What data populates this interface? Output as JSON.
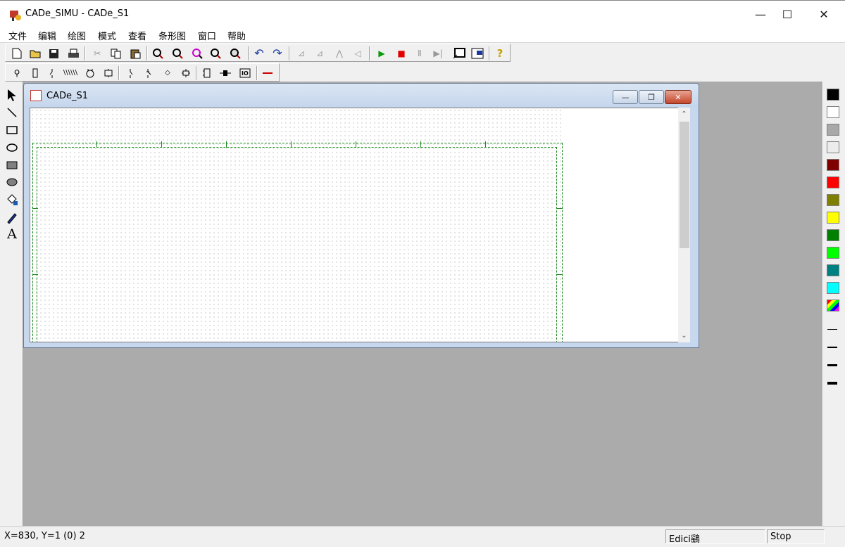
{
  "app": {
    "title": "CADe_SIMU - CADe_S1",
    "controls": {
      "minimize": "—",
      "maximize": "☐",
      "close": "✕"
    }
  },
  "menu": {
    "items": [
      "文件",
      "编辑",
      "绘图",
      "模式",
      "查看",
      "条形图",
      "窗口",
      "帮助"
    ]
  },
  "toolbar_main": {
    "icons": [
      "new-file-icon",
      "open-folder-icon",
      "save-icon",
      "print-icon",
      "cut-icon",
      "copy-icon",
      "paste-icon",
      "zoom-in-icon",
      "zoom-out-icon",
      "zoom-window-icon",
      "zoom-fit-icon",
      "pan-icon",
      "undo-icon",
      "redo-icon",
      "rotate-left-icon",
      "rotate-right-icon",
      "mirror-h-icon",
      "mirror-v-icon",
      "run-icon",
      "stop-icon",
      "pause-icon",
      "step-icon",
      "window-frame-icon",
      "tile-windows-icon",
      "help-icon"
    ]
  },
  "toolbar_components": {
    "icons": [
      "power-source-icon",
      "fuse-icon",
      "contact-icon",
      "switch-icon",
      "motor-icon",
      "relay-icon",
      "contact-no-icon",
      "contact-nc-icon",
      "diode-icon",
      "junction-icon",
      "terminal-icon",
      "coil-icon",
      "plc-io-icon",
      "wire-icon"
    ]
  },
  "tools_left": {
    "icons": [
      "pointer-icon",
      "line-icon",
      "rectangle-icon",
      "ellipse-icon",
      "filled-rectangle-icon",
      "filled-ellipse-icon",
      "fill-bucket-icon",
      "pen-icon",
      "text-icon"
    ],
    "text_tool_label": "A"
  },
  "palette": {
    "colors": [
      "#000000",
      "#ffffff",
      "#a8a8a8",
      "#ececec",
      "#800000",
      "#ff0000",
      "#808000",
      "#ffff00",
      "#008000",
      "#00ff00",
      "#008080",
      "#00ffff"
    ],
    "line_widths": [
      1,
      2,
      3,
      4
    ]
  },
  "child_window": {
    "title": "CADe_S1",
    "controls": {
      "minimize": "—",
      "restore": "❐",
      "close": "✕"
    },
    "frame_color": "#1a8a1a"
  },
  "status": {
    "coords": "X=830, Y=1 (0) 2",
    "mode": "Edici鷂",
    "sim": "Stop"
  }
}
